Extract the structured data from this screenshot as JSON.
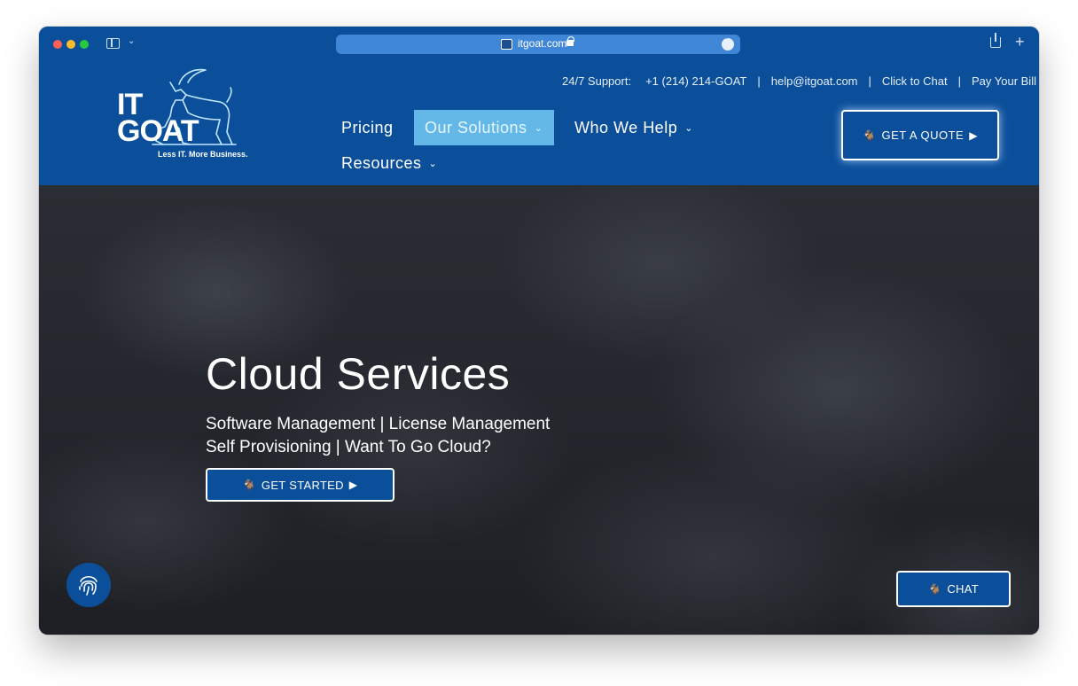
{
  "browser": {
    "url": "itgoat.com"
  },
  "header": {
    "logo": {
      "line1": "IT",
      "line2": "GOAT",
      "tagline": "Less IT. More Business."
    },
    "topbar": {
      "support_label": "24/7 Support:",
      "phone": "+1 (214) 214-GOAT",
      "email": "help@itgoat.com",
      "chat_link": "Click to Chat",
      "bill_link": "Pay Your Bill",
      "separator": "|"
    },
    "nav": {
      "pricing": "Pricing",
      "solutions": "Our Solutions",
      "who_we_help": "Who We Help",
      "resources": "Resources",
      "chevron": "⌄"
    },
    "quote_button": "GET A QUOTE"
  },
  "hero": {
    "title": "Cloud Services",
    "subtitle_line1": "Software Management | License Management",
    "subtitle_line2": "Self Provisioning | Want To Go Cloud?",
    "cta": "GET STARTED"
  },
  "chat_button": "CHAT",
  "icons": {
    "goat": "🐐",
    "play": "▶"
  },
  "colors": {
    "brand_blue": "#0b4f9a",
    "active_nav": "#63b8e8"
  }
}
